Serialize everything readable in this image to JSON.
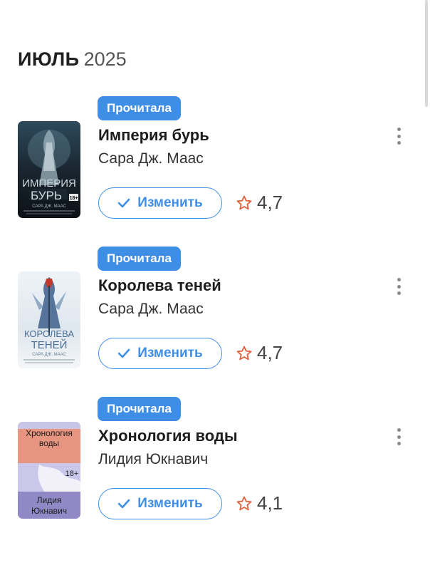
{
  "section": {
    "month": "ИЮЛЬ",
    "year": "2025"
  },
  "books": [
    {
      "status": "Прочитала",
      "title": "Империя бурь",
      "author": "Сара Дж. Маас",
      "edit_label": "Изменить",
      "rating": "4,7",
      "cover": {
        "line1": "ИМПЕРИЯ",
        "line2": "БУРЬ",
        "author": "САРА ДЖ. МААС",
        "age": "18+"
      }
    },
    {
      "status": "Прочитала",
      "title": "Королева теней",
      "author": "Сара Дж. Маас",
      "edit_label": "Изменить",
      "rating": "4,7",
      "cover": {
        "line1": "КОРОЛЕВА",
        "line2": "ТЕНЕЙ",
        "author": "САРА ДЖ. МААС"
      }
    },
    {
      "status": "Прочитала",
      "title": "Хронология воды",
      "author": "Лидия Юкнавич",
      "edit_label": "Изменить",
      "rating": "4,1",
      "cover": {
        "line1": "Хронология",
        "line2": "воды",
        "author_line1": "Лидия",
        "author_line2": "Юкнавич",
        "age": "18+"
      }
    }
  ],
  "colors": {
    "accent": "#3f8ee6",
    "star": "#e0603c",
    "text": "#222222"
  },
  "icons": {
    "menu": "more-vertical-icon",
    "check": "check-icon",
    "star": "star-outline-icon"
  }
}
